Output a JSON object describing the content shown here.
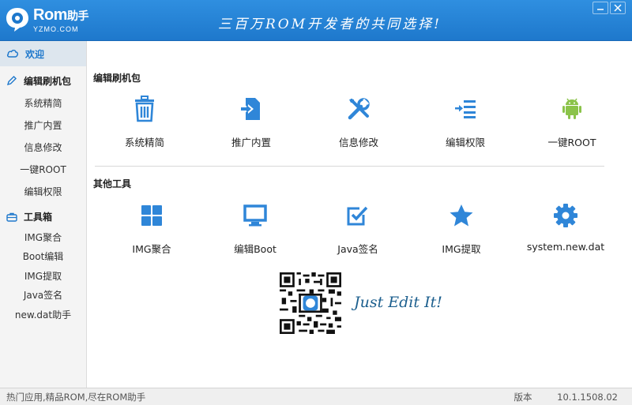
{
  "app": {
    "logo_text": "Rom",
    "logo_cn": "助手",
    "logo_sub": "YZMO.COM",
    "slogan": "三百万ROM开发者的共同选择!"
  },
  "sidebar": {
    "welcome": "欢迎",
    "groups": [
      {
        "label": "编辑刷机包",
        "items": [
          "系统精简",
          "推广内置",
          "信息修改",
          "一键ROOT",
          "编辑权限"
        ]
      },
      {
        "label": "工具箱",
        "items": [
          "IMG聚合",
          "Boot编辑",
          "IMG提取",
          "Java签名",
          "new.dat助手"
        ]
      }
    ]
  },
  "main": {
    "section1": {
      "title": "编辑刷机包",
      "tools": [
        {
          "label": "系统精简",
          "icon": "trash-icon"
        },
        {
          "label": "推广内置",
          "icon": "file-import-icon"
        },
        {
          "label": "信息修改",
          "icon": "tools-icon"
        },
        {
          "label": "编辑权限",
          "icon": "indent-list-icon"
        },
        {
          "label": "一键ROOT",
          "icon": "android-icon"
        }
      ]
    },
    "section2": {
      "title": "其他工具",
      "tools": [
        {
          "label": "IMG聚合",
          "icon": "windows-grid-icon"
        },
        {
          "label": "编辑Boot",
          "icon": "monitor-icon"
        },
        {
          "label": "Java签名",
          "icon": "check-square-icon"
        },
        {
          "label": "IMG提取",
          "icon": "star-icon"
        },
        {
          "label": "system.new.dat",
          "icon": "gear-icon"
        }
      ]
    },
    "tagline": "Just Edit It!"
  },
  "status": {
    "left": "热门应用,精品ROM,尽在ROM助手",
    "version_label": "版本",
    "version": "10.1.1508.02"
  },
  "colors": {
    "accent": "#1e78cc",
    "icon_blue": "#2f86d8",
    "android_green": "#8bc34a"
  }
}
